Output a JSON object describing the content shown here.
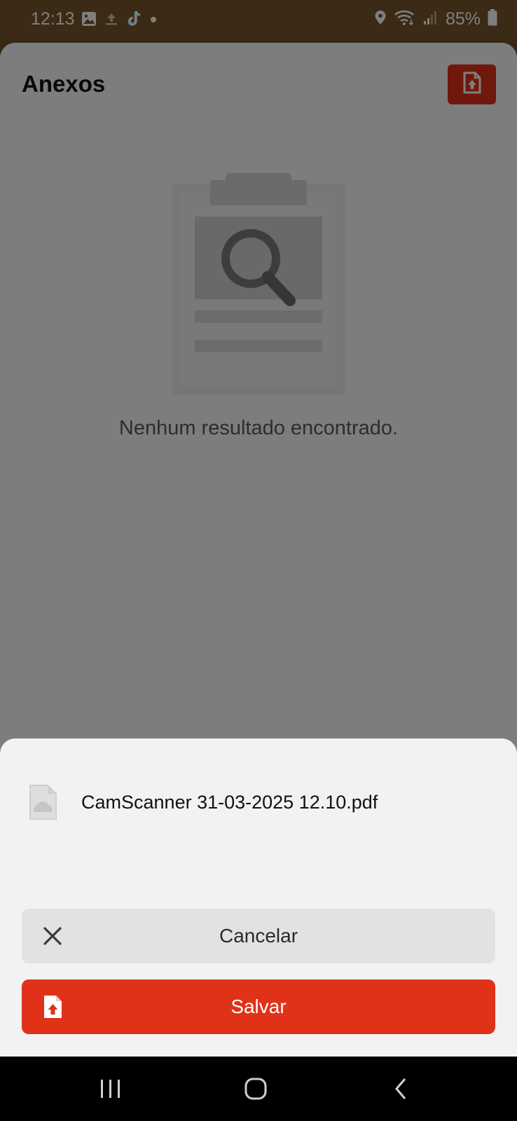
{
  "status_bar": {
    "time": "12:13",
    "battery": "85%",
    "icons": [
      "gallery-icon",
      "upload-icon",
      "tiktok-icon",
      "dot-icon",
      "location-icon",
      "wifi-icon",
      "signal-icon",
      "battery-icon"
    ]
  },
  "page": {
    "title": "Anexos",
    "upload_button_icon": "file-upload-icon",
    "empty_state": {
      "illustration": "clipboard-search-icon",
      "message": "Nenhum resultado encontrado."
    }
  },
  "bottom_sheet": {
    "file": {
      "icon": "file-image-icon",
      "name": "CamScanner 31-03-2025 12.10.pdf"
    },
    "cancel_label": "Cancelar",
    "save_label": "Salvar"
  },
  "nav_bar": {
    "buttons": [
      "recents-icon",
      "home-icon",
      "back-icon"
    ]
  },
  "colors": {
    "accent": "#e03219",
    "status_bar": "#76542a",
    "sheet_bg": "#f2f2f2",
    "cancel_bg": "#e2e2e2"
  }
}
